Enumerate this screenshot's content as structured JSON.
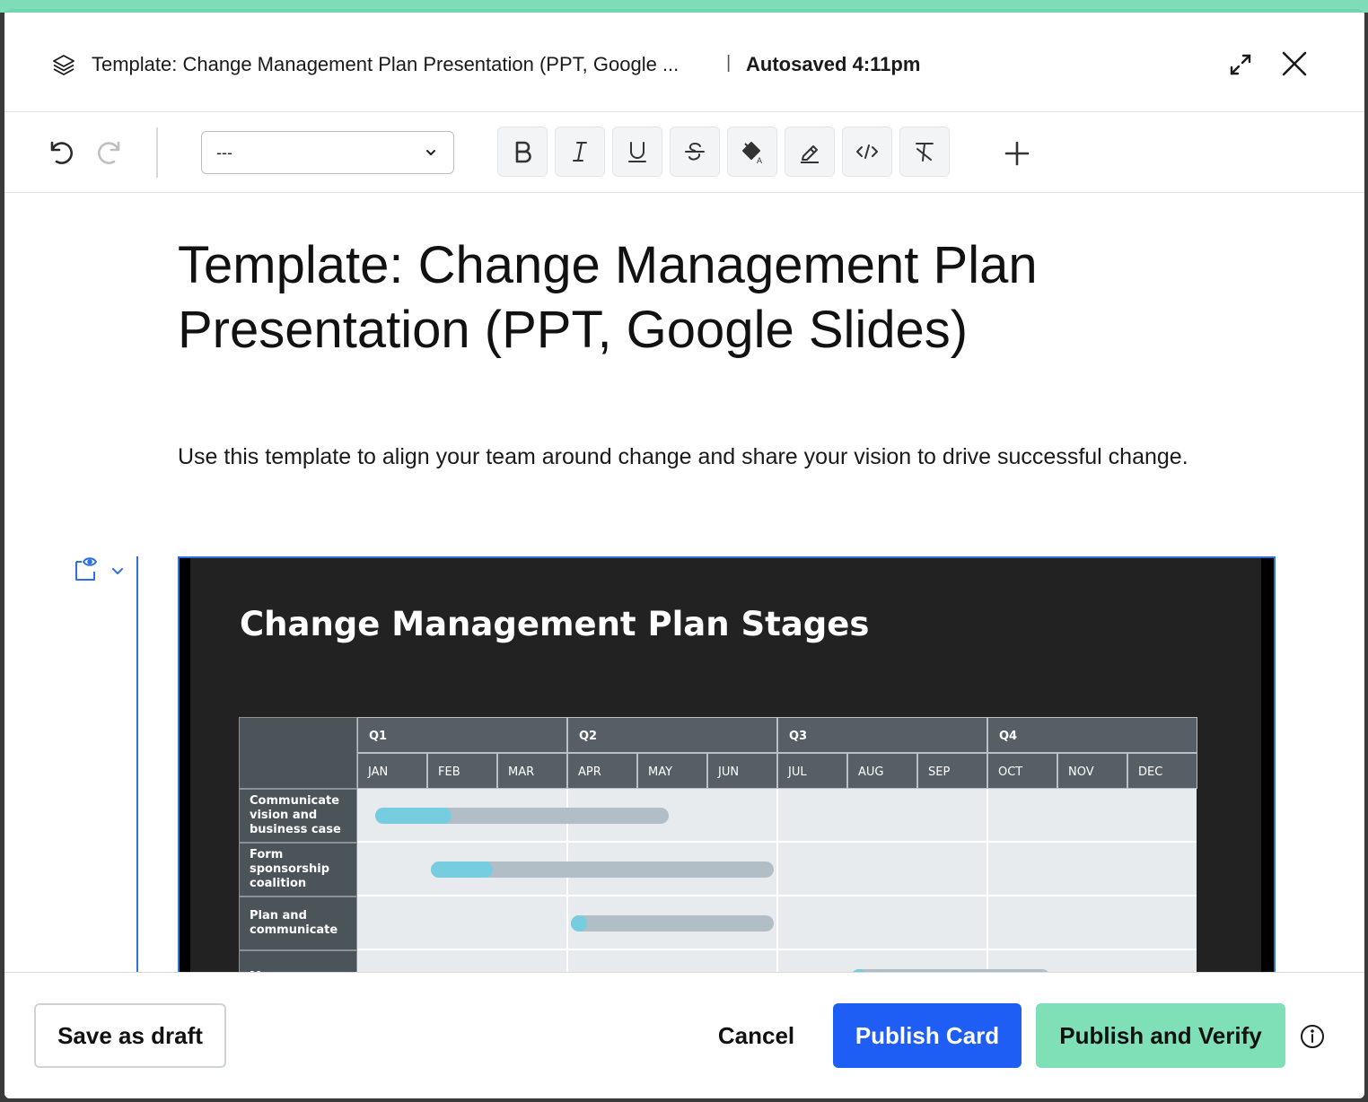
{
  "header": {
    "title": "Template: Change Management Plan Presentation (PPT, Google ...",
    "separator": "|",
    "autosave": "Autosaved 4:11pm"
  },
  "toolbar": {
    "style_select_value": "---",
    "buttons": [
      "bold",
      "italic",
      "underline",
      "strikethrough",
      "text-color",
      "highlight",
      "code",
      "clear-formatting"
    ]
  },
  "document": {
    "title": "Template: Change Management Plan Presentation (PPT, Google Slides)",
    "description": "Use this template to align your team around change and share your vision to drive successful change."
  },
  "slide": {
    "title": "Change Management Plan Stages",
    "quarters": [
      "Q1",
      "Q2",
      "Q3",
      "Q4"
    ],
    "months": [
      "JAN",
      "FEB",
      "MAR",
      "APR",
      "MAY",
      "JUN",
      "JUL",
      "AUG",
      "SEP",
      "OCT",
      "NOV",
      "DEC"
    ],
    "tasks": [
      {
        "label": "Communicate vision and business case",
        "start_month": 0.25,
        "end_month": 4.45,
        "progress": 0.26
      },
      {
        "label": "Form sponsorship coalition",
        "start_month": 1.05,
        "end_month": 5.95,
        "progress": 0.18
      },
      {
        "label": "Plan and communicate",
        "start_month": 3.05,
        "end_month": 5.95,
        "progress": 0.05
      },
      {
        "label": "Manage",
        "start_month": 7.05,
        "end_month": 9.9,
        "progress": 0.05
      }
    ],
    "colors": {
      "background": "#222222",
      "progress": "#77cde0",
      "bar": "#b2bec5"
    }
  },
  "footer": {
    "save_draft": "Save as draft",
    "cancel": "Cancel",
    "publish": "Publish Card",
    "publish_verify": "Publish and Verify"
  }
}
